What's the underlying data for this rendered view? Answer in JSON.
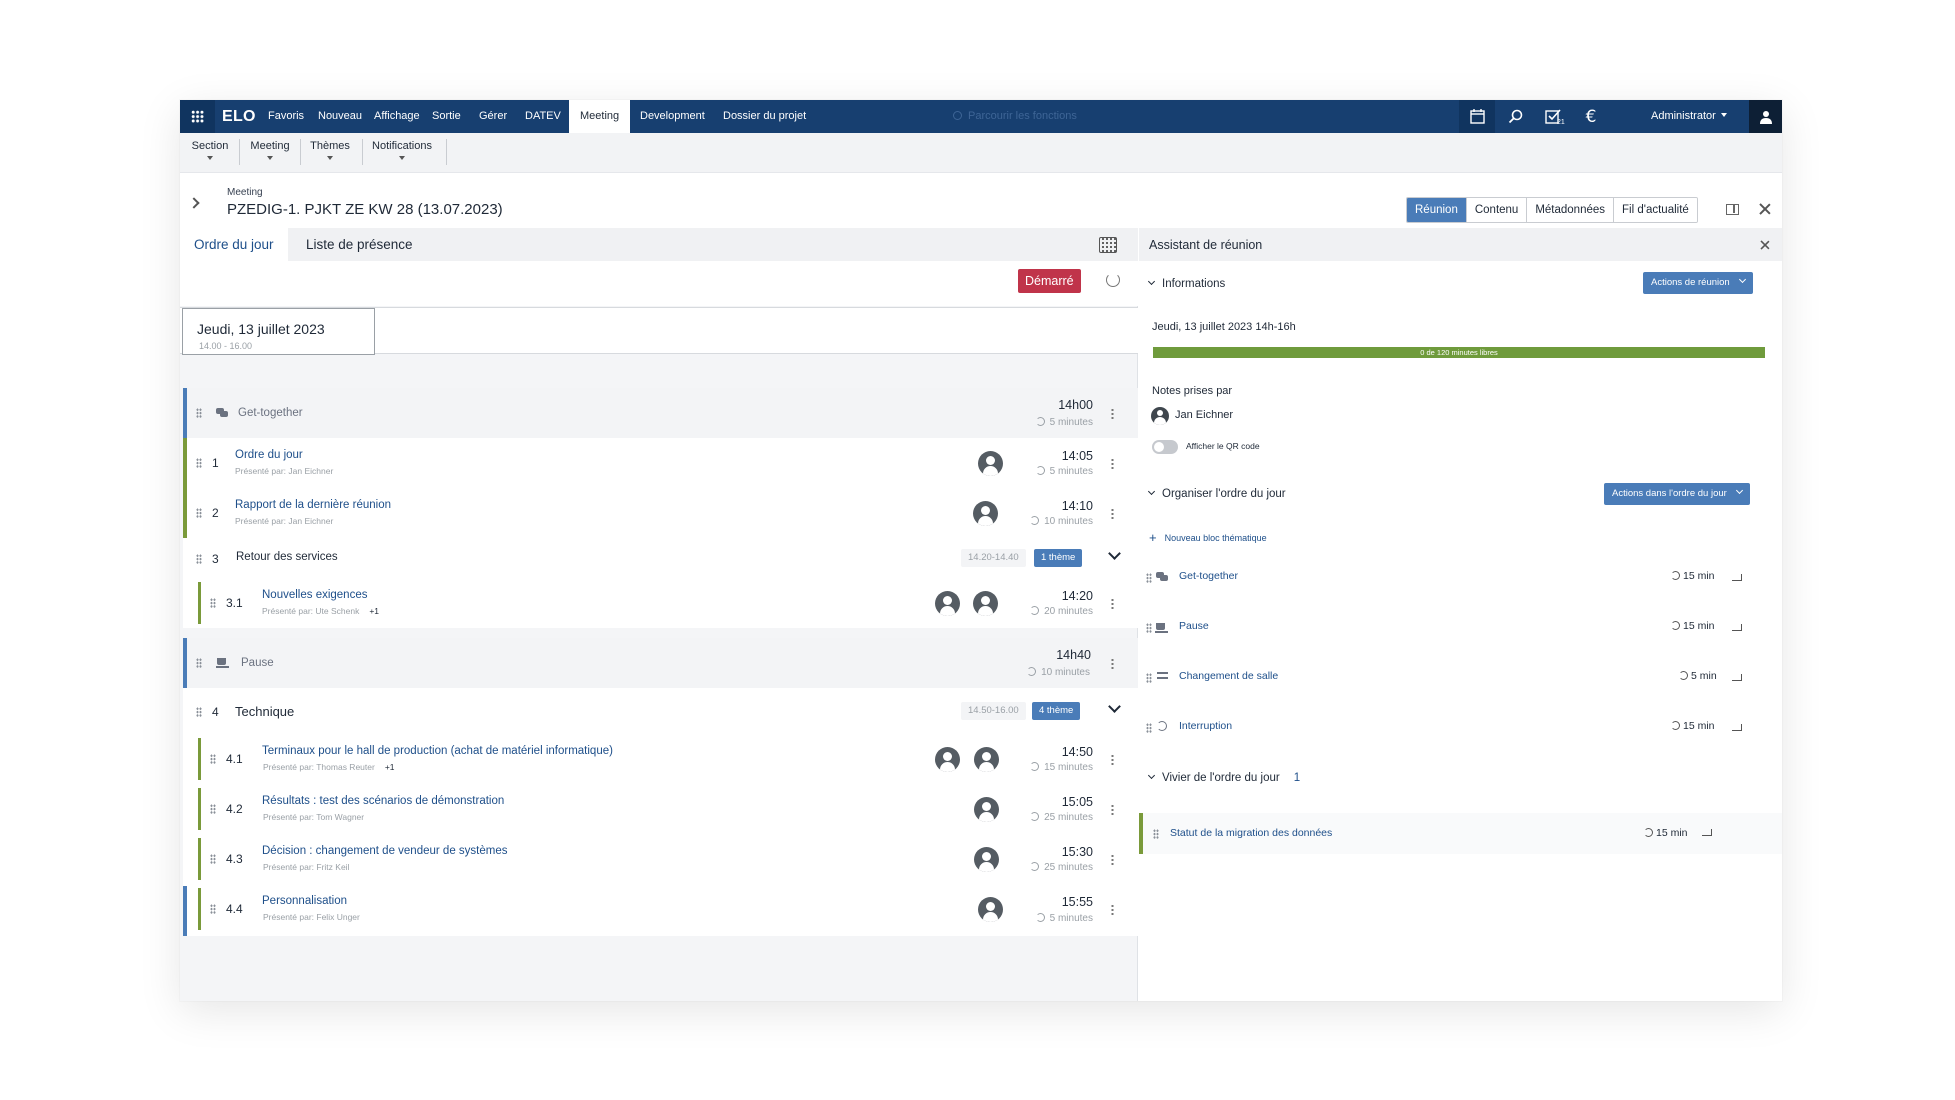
{
  "topbar": {
    "brand": "ELO",
    "menu": [
      "Favoris",
      "Nouveau",
      "Affichage",
      "Sortie",
      "Gérer",
      "DATEV",
      "Meeting",
      "Development",
      "Dossier du projet"
    ],
    "search_placeholder": "Parcourir les fonctions",
    "tasks_badge": "21",
    "user": "Administrator",
    "icons": [
      "apps-grid-icon",
      "elo-calendar-icon",
      "search-icon",
      "tasks-icon",
      "euro-icon",
      "user-icon"
    ],
    "accent": "#173f70"
  },
  "ribbon": {
    "items": [
      "Section",
      "Meeting",
      "Thèmes",
      "Notifications"
    ]
  },
  "meeting": {
    "kicker": "Meeting",
    "title": "PZEDIG-1. PJKT ZE KW 28 (13.07.2023)",
    "views": [
      "Réunion",
      "Contenu",
      "Métadonnées",
      "Fil d'actualité"
    ],
    "active_view": "Réunion"
  },
  "left": {
    "tabs": [
      "Ordre du jour",
      "Liste de présence"
    ],
    "status_button": "Démarré",
    "status_color": "#c0344a",
    "date": {
      "label": "Jeudi, 13 juillet 2023",
      "range": "14.00 - 16.00"
    },
    "rows": {
      "r0": {
        "title": "Get-together",
        "time": "14h00",
        "dur": "5 minutes"
      },
      "r1": {
        "num": "1",
        "title": "Ordre du jour",
        "presenter": "Présenté par: Jan Eichner",
        "time": "14:05",
        "dur": "5 minutes"
      },
      "r2": {
        "num": "2",
        "title": "Rapport de la dernière réunion",
        "presenter": "Présenté par: Jan Eichner",
        "time": "14:10",
        "dur": "10 minutes"
      },
      "r3": {
        "num": "3",
        "title": "Retour des services",
        "range": "14.20-14.40",
        "tag": "1 thème"
      },
      "r4": {
        "num": "3.1",
        "title": "Nouvelles exigences",
        "presenter": "Présenté par: Ute Schenk",
        "extra": "+1",
        "time": "14:20",
        "dur": "20 minutes"
      },
      "r5": {
        "title": "Pause",
        "time": "14h40",
        "dur": "10 minutes"
      },
      "r6": {
        "num": "4",
        "title": "Technique",
        "range": "14.50-16.00",
        "tag": "4 thème"
      },
      "r7": {
        "num": "4.1",
        "title": "Terminaux pour le hall de production (achat de matériel informatique)",
        "presenter": "Présenté par: Thomas Reuter",
        "extra": "+1",
        "time": "14:50",
        "dur": "15 minutes"
      },
      "r8": {
        "num": "4.2",
        "title": "Résultats : test des scénarios de démonstration",
        "presenter": "Présenté par: Tom Wagner",
        "time": "15:05",
        "dur": "25 minutes"
      },
      "r9": {
        "num": "4.3",
        "title": "Décision : changement de vendeur de systèmes",
        "presenter": "Présenté par: Fritz Keil",
        "time": "15:30",
        "dur": "25 minutes"
      },
      "r10": {
        "num": "4.4",
        "title": "Personnalisation",
        "presenter": "Présenté par: Felix Unger",
        "time": "15:55",
        "dur": "5 minutes"
      }
    }
  },
  "assistant": {
    "title": "Assistant de réunion",
    "info_header": "Informations",
    "info_action": "Actions de réunion",
    "datetime": "Jeudi, 13 juillet 2023 14h-16h",
    "progress_text": "0 de 120 minutes libres",
    "progress_fraction": 1.0,
    "progress_color": "#6f9b3c",
    "notes_label": "Notes prises par",
    "note_taker": "Jan Eichner",
    "qr_label": "Afficher le QR code",
    "qr_enabled": false,
    "organize_header": "Organiser l'ordre du jour",
    "organize_action": "Actions dans l'ordre du jour",
    "new_block": "Nouveau bloc thématique",
    "blocks": [
      {
        "name": "Get-together",
        "minutes": "15 min",
        "icon": "chat-icon"
      },
      {
        "name": "Pause",
        "minutes": "15 min",
        "icon": "coffee-icon"
      },
      {
        "name": "Changement de salle",
        "minutes": "5 min",
        "icon": "swap-icon"
      },
      {
        "name": "Interruption",
        "minutes": "15 min",
        "icon": "history-icon"
      }
    ],
    "pool_header": "Vivier de l'ordre du jour",
    "pool_count": "1",
    "pool_items": [
      {
        "name": "Statut de la migration des données",
        "minutes": "15 min"
      }
    ]
  }
}
